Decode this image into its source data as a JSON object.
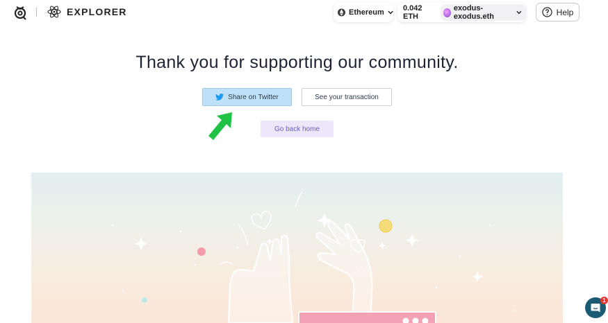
{
  "header": {
    "app_name": "EXPLORER",
    "network": {
      "label": "Ethereum"
    },
    "wallet": {
      "balance": "0.042 ETH",
      "account": "exodus-exodus.eth"
    },
    "help_label": "Help"
  },
  "main": {
    "headline": "Thank you for supporting our community.",
    "share_twitter_label": "Share on Twitter",
    "see_transaction_label": "See your transaction",
    "go_home_label": "Go back home"
  },
  "chat": {
    "badge_count": "1"
  },
  "icons": {
    "logo": "brand-logo-icon",
    "explorer": "atom-icon",
    "network": "ethereum-icon",
    "twitter": "twitter-bird-icon",
    "help": "question-circle-icon",
    "annotation": "green-arrow-icon",
    "chat": "chat-bubble-icon"
  },
  "colors": {
    "twitter_button_bg": "#bfe1f7",
    "home_button_bg": "#ece7fb",
    "home_button_text": "#6b5bc5",
    "annotation_arrow": "#1fc244",
    "chat_bg": "#1b5a73",
    "badge_bg": "#e0372f"
  }
}
